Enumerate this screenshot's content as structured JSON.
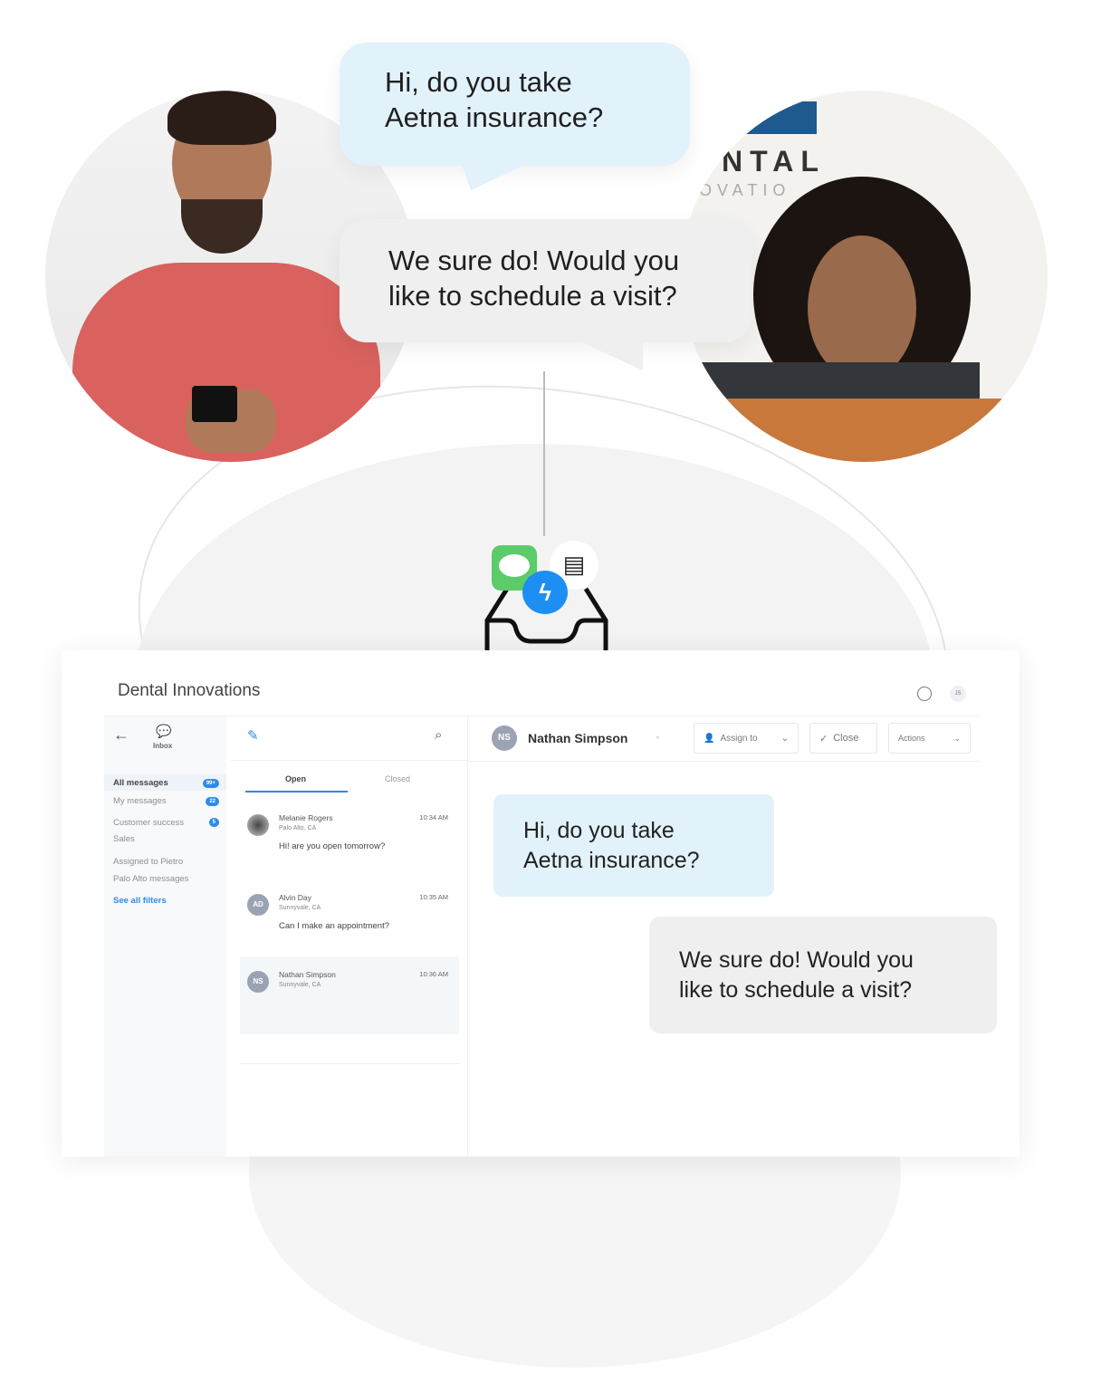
{
  "hero": {
    "patient_message": [
      "Hi, do you take",
      "Aetna insurance?"
    ],
    "staff_reply": [
      "We sure do! Would you",
      "like to schedule a visit?"
    ],
    "clinic_sign_text": [
      "NTAL",
      "OVATIO"
    ]
  },
  "channel_icons": [
    "sms-icon",
    "messenger-icon",
    "chat-icon",
    "inbox-tray-icon"
  ],
  "app": {
    "title": "Dental Innovations",
    "header_icons": {
      "chat": "chat-bubble-icon",
      "user_initials": "JS"
    },
    "sidebar": {
      "inbox_label": "Inbox",
      "items": [
        {
          "label": "All messages",
          "badge": "99+",
          "active": true
        },
        {
          "label": "My messages",
          "badge": "22"
        },
        {
          "label": "Customer success",
          "badge": "5"
        },
        {
          "label": "Sales"
        },
        {
          "label": "Assigned to Pietro"
        },
        {
          "label": "Palo Alto messages"
        }
      ],
      "see_all": "See all filters"
    },
    "list": {
      "tabs": [
        "Open",
        "Closed"
      ],
      "active_tab": "Open",
      "conversations": [
        {
          "name": "Melanie Rogers",
          "location": "Palo Alto, CA",
          "time": "10:34 AM",
          "message": "Hi! are you open tomorrow?",
          "initials": ""
        },
        {
          "name": "Alvin Day",
          "location": "Sunnyvale, CA",
          "time": "10:35 AM",
          "message": "Can I make an appointment?",
          "initials": "AD"
        },
        {
          "name": "Nathan Simpson",
          "location": "Sunnyvale, CA",
          "time": "10:36 AM",
          "message": "",
          "initials": "NS"
        }
      ]
    },
    "thread": {
      "contact_initials": "NS",
      "contact_name": "Nathan Simpson",
      "assign_label": "Assign to",
      "close_label": "Close",
      "actions_label": "Actions",
      "messages": [
        {
          "from": "patient",
          "lines": [
            "Hi, do you take",
            "Aetna insurance?"
          ]
        },
        {
          "from": "staff",
          "lines": [
            "We sure do! Would you",
            "like to schedule a visit?"
          ]
        }
      ]
    }
  },
  "colors": {
    "accent": "#2f8be6",
    "patient_bubble": "#e2f2fb",
    "staff_bubble": "#efefef",
    "sms_green": "#5ccb6a",
    "messenger_blue": "#1e8ff2"
  }
}
